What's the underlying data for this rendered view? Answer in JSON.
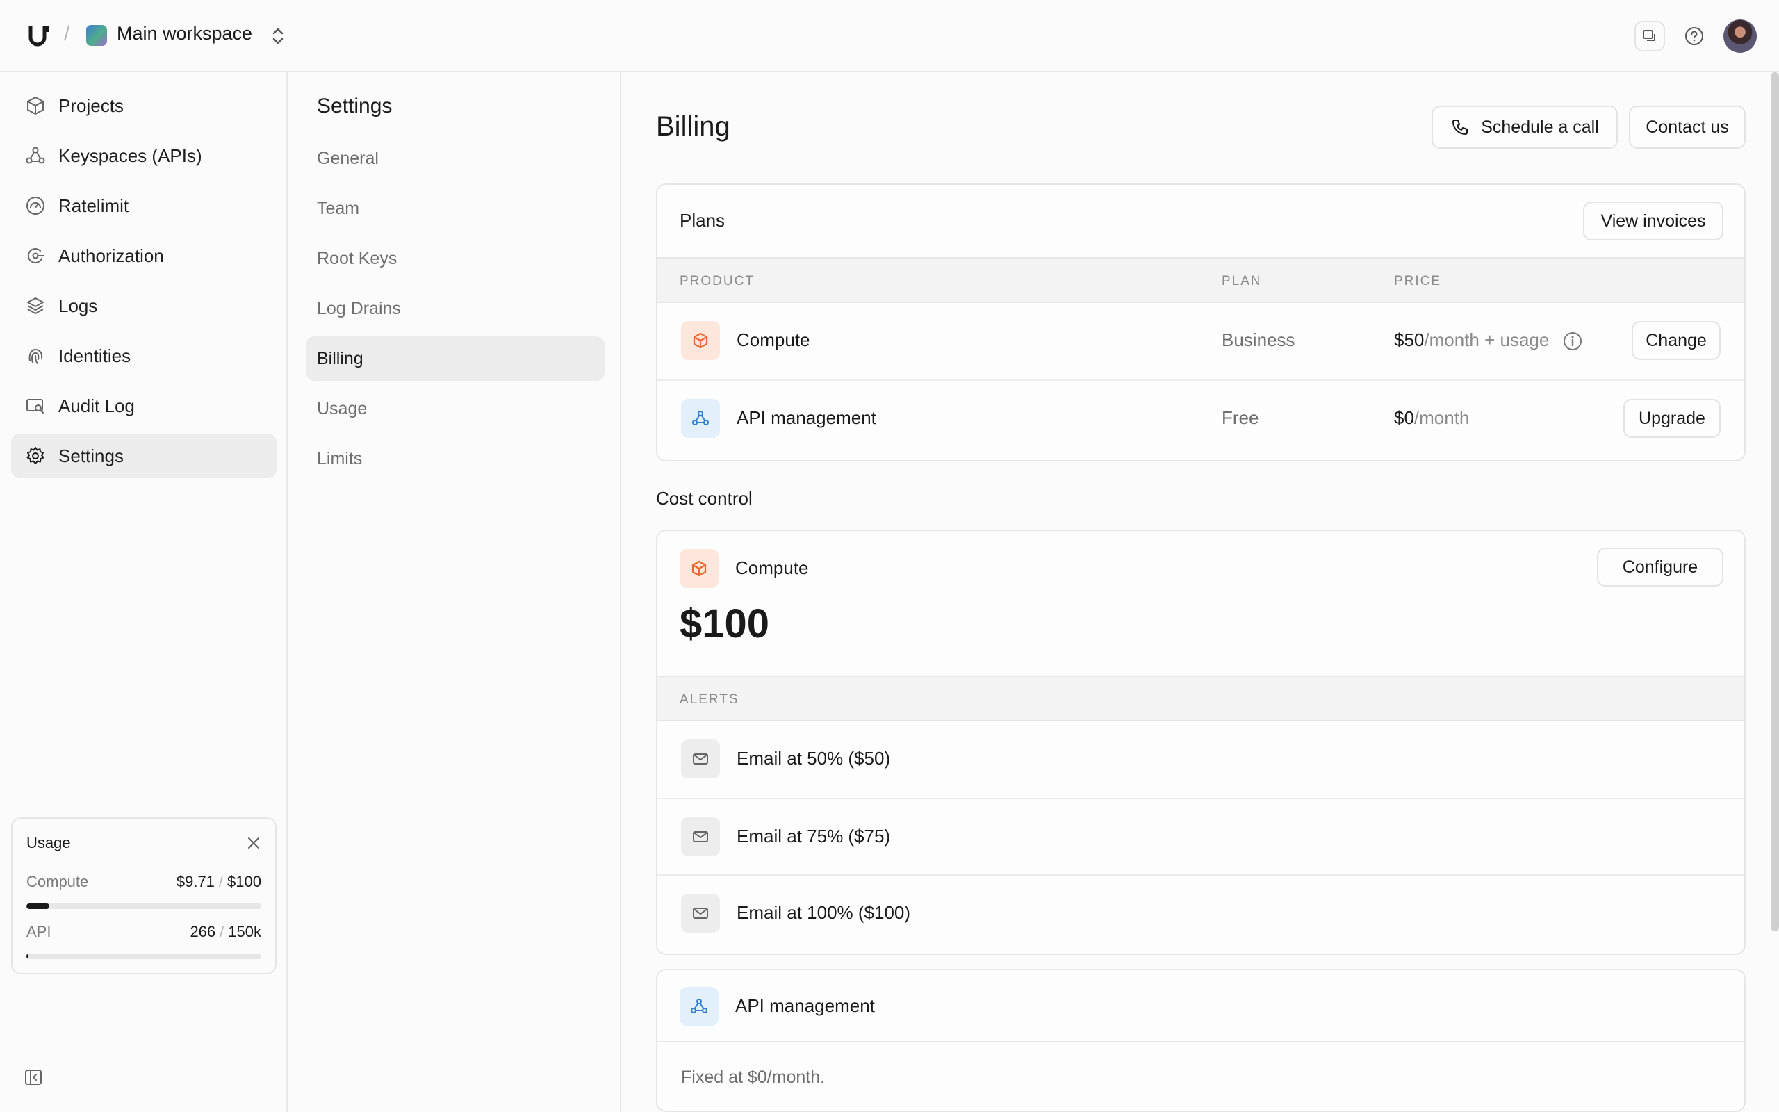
{
  "topbar": {
    "separator": "/",
    "workspace_name": "Main workspace"
  },
  "sidebar": {
    "items": [
      {
        "label": "Projects",
        "icon": "cube-icon"
      },
      {
        "label": "Keyspaces (APIs)",
        "icon": "nodes-icon"
      },
      {
        "label": "Ratelimit",
        "icon": "gauge-icon"
      },
      {
        "label": "Authorization",
        "icon": "shield-key-icon"
      },
      {
        "label": "Logs",
        "icon": "layers-icon"
      },
      {
        "label": "Identities",
        "icon": "fingerprint-icon"
      },
      {
        "label": "Audit Log",
        "icon": "monitor-search-icon"
      },
      {
        "label": "Settings",
        "icon": "gear-icon"
      }
    ],
    "active": "Settings",
    "usage": {
      "title": "Usage",
      "compute_label": "Compute",
      "compute_used": "$9.71",
      "compute_limit": "$100",
      "compute_fraction": 0.097,
      "api_label": "API",
      "api_used": "266",
      "api_limit": "150k",
      "api_fraction": 0.002,
      "slash": "/"
    }
  },
  "settings": {
    "title": "Settings",
    "items": [
      "General",
      "Team",
      "Root Keys",
      "Log Drains",
      "Billing",
      "Usage",
      "Limits"
    ],
    "active": "Billing"
  },
  "billing": {
    "title": "Billing",
    "schedule_call": "Schedule a call",
    "contact_us": "Contact us",
    "plans": {
      "title": "Plans",
      "view_invoices": "View invoices",
      "headers": [
        "PRODUCT",
        "PLAN",
        "PRICE"
      ],
      "rows": [
        {
          "product": "Compute",
          "plan": "Business",
          "price_amount": "$50",
          "price_rest": "/month + usage",
          "action": "Change"
        },
        {
          "product": "API management",
          "plan": "Free",
          "price_amount": "$0",
          "price_rest": "/month",
          "action": "Upgrade"
        }
      ]
    },
    "cost_control": {
      "title": "Cost control",
      "compute": {
        "label": "Compute",
        "configure": "Configure",
        "amount": "$100",
        "alerts_header": "ALERTS",
        "alerts": [
          "Email at 50% ($50)",
          "Email at 75% ($75)",
          "Email at 100% ($100)"
        ]
      },
      "api": {
        "label": "API management",
        "note": "Fixed at $0/month."
      }
    }
  },
  "colors": {
    "accent_orange": "#e8692e",
    "accent_blue": "#2f7fd3",
    "active_bg": "#ececec"
  }
}
